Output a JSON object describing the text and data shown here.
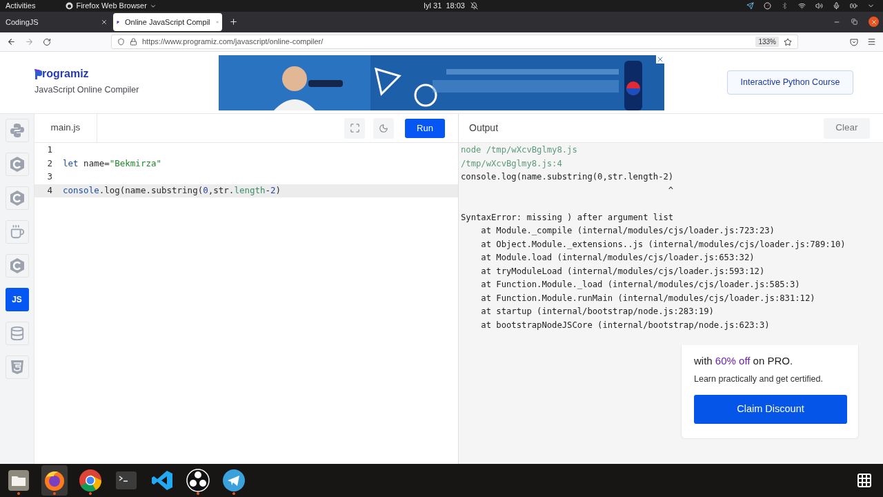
{
  "system_bar": {
    "activities": "Activities",
    "app_menu": "Firefox Web Browser",
    "clock": "Iyl 31  18:03"
  },
  "browser_tabs": [
    {
      "title": "CodingJS",
      "selected": false
    },
    {
      "title": "Online JavaScript Compil",
      "selected": true
    }
  ],
  "address_bar": {
    "url": "https://www.programiz.com/javascript/online-compiler/",
    "zoom": "133%"
  },
  "header": {
    "logo": "rogramiz",
    "subtitle": "JavaScript Online Compiler",
    "course_button": "Interactive Python Course"
  },
  "languages": [
    {
      "kind": "python",
      "selected": false
    },
    {
      "kind": "c",
      "selected": false
    },
    {
      "kind": "cpp",
      "selected": false
    },
    {
      "kind": "java",
      "selected": false
    },
    {
      "kind": "csharp",
      "selected": false
    },
    {
      "kind": "js",
      "label": "JS",
      "selected": true
    },
    {
      "kind": "sql",
      "selected": false
    },
    {
      "kind": "html",
      "selected": false
    }
  ],
  "editor": {
    "file_tab": "main.js",
    "run_button": "Run",
    "lines": [
      {
        "number": "1",
        "active": false
      },
      {
        "number": "2",
        "active": false,
        "tokens": [
          {
            "text": "let",
            "kind": "keyword"
          },
          {
            "text": " name=",
            "kind": "plain"
          },
          {
            "text": "\"Bekmirza\"",
            "kind": "string"
          }
        ]
      },
      {
        "number": "3",
        "active": false
      },
      {
        "number": "4",
        "active": true,
        "tokens": [
          {
            "text": "console",
            "kind": "keyword"
          },
          {
            "text": ".log(name.substring(",
            "kind": "plain"
          },
          {
            "text": "0",
            "kind": "number"
          },
          {
            "text": ",str.",
            "kind": "plain"
          },
          {
            "text": "length",
            "kind": "property"
          },
          {
            "text": "-",
            "kind": "plain"
          },
          {
            "text": "2",
            "kind": "number"
          },
          {
            "text": ")",
            "kind": "plain"
          }
        ]
      }
    ]
  },
  "output": {
    "title": "Output",
    "clear_button": "Clear",
    "lines": [
      {
        "text": "node /tmp/wXcvBglmy8.js",
        "kind": "info"
      },
      {
        "text": "/tmp/wXcvBglmy8.js:4",
        "kind": "info"
      },
      {
        "text": "console.log(name.substring(0,str.length-2)",
        "kind": "plain"
      },
      {
        "text": "                                         ^",
        "kind": "plain"
      },
      {
        "text": "SyntaxError: missing ) after argument list",
        "kind": "plain",
        "blank_before": true
      },
      {
        "text": "    at Module._compile (internal/modules/cjs/loader.js:723:23)",
        "kind": "plain"
      },
      {
        "text": "    at Object.Module._extensions..js (internal/modules/cjs/loader.js:789:10)",
        "kind": "plain"
      },
      {
        "text": "    at Module.load (internal/modules/cjs/loader.js:653:32)",
        "kind": "plain"
      },
      {
        "text": "    at tryModuleLoad (internal/modules/cjs/loader.js:593:12)",
        "kind": "plain"
      },
      {
        "text": "    at Function.Module._load (internal/modules/cjs/loader.js:585:3)",
        "kind": "plain"
      },
      {
        "text": "    at Function.Module.runMain (internal/modules/cjs/loader.js:831:12)",
        "kind": "plain"
      },
      {
        "text": "    at startup (internal/bootstrap/node.js:283:19)",
        "kind": "plain"
      },
      {
        "text": "    at bootstrapNodeJSCore (internal/bootstrap/node.js:623:3)",
        "kind": "plain"
      }
    ]
  },
  "promo": {
    "offer_parts": [
      {
        "text": "with ",
        "highlight": false
      },
      {
        "text": "60% off",
        "highlight": true
      },
      {
        "text": " on PRO.",
        "highlight": false
      }
    ],
    "note": "Learn practically and get certified.",
    "button": "Claim Discount"
  },
  "dock": [
    {
      "kind": "files",
      "running": true,
      "selected": false
    },
    {
      "kind": "firefox",
      "running": true,
      "selected": true
    },
    {
      "kind": "chrome",
      "running": true,
      "selected": false
    },
    {
      "kind": "terminal",
      "running": false,
      "selected": false
    },
    {
      "kind": "vscode",
      "running": false,
      "selected": false
    },
    {
      "kind": "obs",
      "running": true,
      "selected": false
    },
    {
      "kind": "telegram",
      "running": true,
      "selected": false
    },
    {
      "kind": "apps",
      "running": false,
      "selected": false
    }
  ]
}
